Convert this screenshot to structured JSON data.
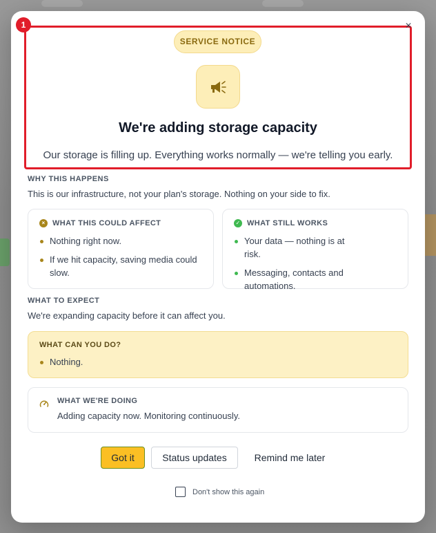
{
  "modal": {
    "close_glyph": "×",
    "highlight_number": "1",
    "pill": "SERVICE NOTICE",
    "icon": "megaphone-icon",
    "title": "We're adding storage capacity",
    "subtitle": "Our storage is filling up. Everything works normally — we're telling you early."
  },
  "why": {
    "label": "WHY THIS HAPPENS",
    "text": "This is our infrastructure, not your plan's storage. Nothing on your side to fix."
  },
  "affect_card": {
    "label": "WHAT THIS COULD AFFECT",
    "icon": "warning-x-icon",
    "items": [
      "Nothing right now.",
      "If we hit capacity, saving media could slow."
    ]
  },
  "works_card": {
    "label": "WHAT STILL WORKS",
    "icon": "check-circle-icon",
    "items": [
      "Your data — nothing is at risk.",
      "Messaging, contacts and automations."
    ]
  },
  "expect": {
    "label": "WHAT TO EXPECT",
    "text": "We're expanding capacity before it can affect you."
  },
  "can_do": {
    "label": "WHAT CAN YOU DO?",
    "items": [
      "Nothing."
    ]
  },
  "doing": {
    "label": "WHAT WE'RE DOING",
    "icon": "gauge-icon",
    "text": "Adding capacity now. Monitoring continuously."
  },
  "buttons": {
    "primary": "Got it",
    "secondary": "Status updates",
    "link": "Remind me later"
  },
  "dont_show": {
    "label": "Don't show this again",
    "checked": false
  },
  "colors": {
    "accent": "#fbbf24",
    "pill_bg": "#fdeeb8",
    "highlight": "#e11d2a",
    "bullet_gold": "#a8861b",
    "bullet_green": "#3fb950"
  }
}
